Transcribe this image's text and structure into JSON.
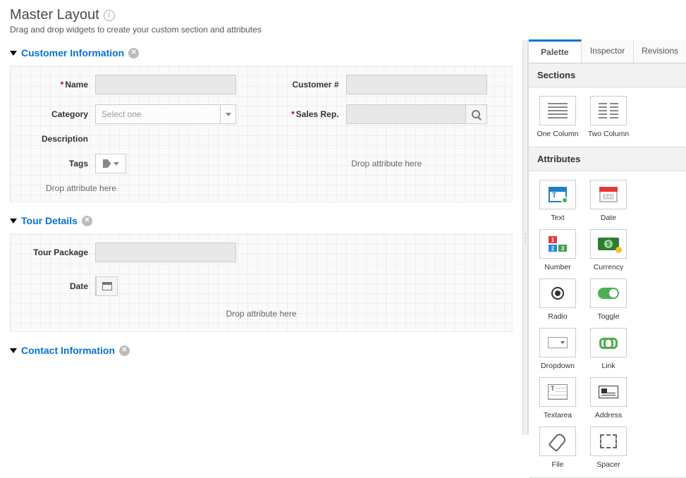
{
  "header": {
    "title": "Master Layout",
    "subtitle": "Drag and drop widgets to create your custom section and attributes"
  },
  "sections": [
    {
      "title": "Customer Information",
      "layout": "two-col",
      "rows": [
        {
          "left": {
            "label": "Name",
            "required": true,
            "type": "text"
          },
          "right": {
            "label": "Customer #",
            "required": false,
            "type": "text"
          }
        },
        {
          "left": {
            "label": "Category",
            "required": false,
            "type": "select",
            "placeholder": "Select one"
          },
          "right": {
            "label": "Sales Rep.",
            "required": true,
            "type": "search"
          }
        },
        {
          "left": {
            "label": "Description",
            "required": false,
            "type": "none"
          }
        },
        {
          "left": {
            "label": "Tags",
            "required": false,
            "type": "tags"
          },
          "right": {
            "label": "",
            "type": "drophint",
            "text": "Drop attribute here"
          }
        }
      ],
      "dropHint": "Drop attribute here"
    },
    {
      "title": "Tour Details",
      "layout": "one-col",
      "rows": [
        {
          "left": {
            "label": "Tour Package",
            "required": false,
            "type": "text"
          }
        },
        {
          "left": {
            "label": "Date",
            "required": false,
            "type": "date"
          }
        }
      ],
      "dropHintCenter": "Drop attribute here"
    },
    {
      "title": "Contact Information",
      "layout": "two-col",
      "rows": []
    }
  ],
  "side": {
    "tabs": {
      "palette": "Palette",
      "inspector": "Inspector",
      "revisions": "Revisions",
      "active": "palette"
    },
    "sectionsHeading": "Sections",
    "sectionsWidgets": [
      {
        "label": "One Column",
        "icon": "onecol"
      },
      {
        "label": "Two Column",
        "icon": "twocol"
      }
    ],
    "attributesHeading": "Attributes",
    "attributeWidgets": [
      {
        "label": "Text",
        "icon": "text"
      },
      {
        "label": "Date",
        "icon": "date"
      },
      {
        "label": "Number",
        "icon": "number"
      },
      {
        "label": "Currency",
        "icon": "currency"
      },
      {
        "label": "Radio",
        "icon": "radio"
      },
      {
        "label": "Toggle",
        "icon": "toggle"
      },
      {
        "label": "Dropdown",
        "icon": "dropdown"
      },
      {
        "label": "Link",
        "icon": "link"
      },
      {
        "label": "Textarea",
        "icon": "textarea"
      },
      {
        "label": "Address",
        "icon": "address"
      },
      {
        "label": "File",
        "icon": "file"
      },
      {
        "label": "Spacer",
        "icon": "spacer"
      }
    ]
  }
}
